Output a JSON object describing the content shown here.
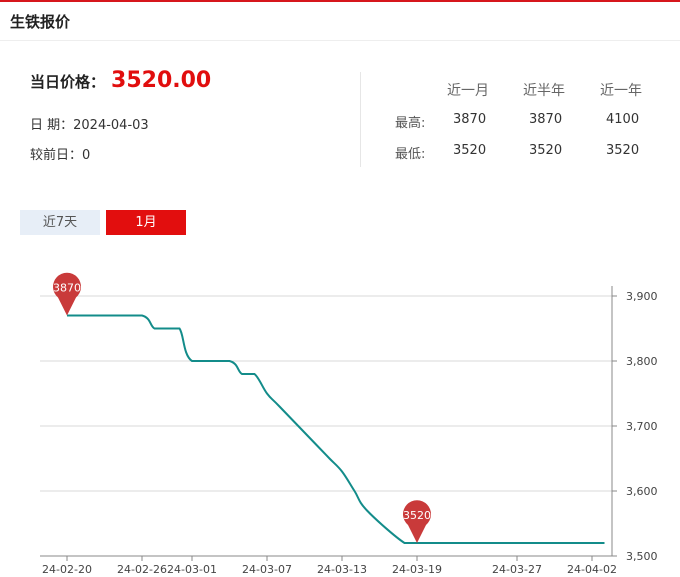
{
  "header": {
    "title": "生铁报价"
  },
  "price": {
    "label": "当日价格：",
    "value": "3520.00",
    "date_text": "日 期：2024-04-03",
    "change_text": "较前日：0"
  },
  "stats": {
    "columns": [
      "近一月",
      "近半年",
      "近一年"
    ],
    "rows": [
      {
        "label": "最高:",
        "values": [
          "3870",
          "3870",
          "4100"
        ]
      },
      {
        "label": "最低:",
        "values": [
          "3520",
          "3520",
          "3520"
        ]
      }
    ]
  },
  "tabs": [
    {
      "label": "近7天",
      "active": false
    },
    {
      "label": "1月",
      "active": true
    }
  ],
  "colors": {
    "accent": "#e10e0e",
    "line": "#138c8a",
    "pin": "#c93a3a"
  },
  "chart_data": {
    "type": "line",
    "title": "",
    "xlabel": "",
    "ylabel": "",
    "ylim": [
      3500,
      3900
    ],
    "yticks": [
      "3,900",
      "3,800",
      "3,700",
      "3,600",
      "3,500"
    ],
    "ytick_values": [
      3900,
      3800,
      3700,
      3600,
      3500
    ],
    "xticks": [
      "24-02-20",
      "24-02-26",
      "24-03-01",
      "24-03-07",
      "24-03-13",
      "24-03-19",
      "24-03-27",
      "24-04-02"
    ],
    "grid": true,
    "series": [
      {
        "x": [
          "24-02-20",
          "24-02-21",
          "24-02-22",
          "24-02-23",
          "24-02-26",
          "24-02-27",
          "24-02-28",
          "24-02-29",
          "24-03-01",
          "24-03-04",
          "24-03-05",
          "24-03-06",
          "24-03-07",
          "24-03-08",
          "24-03-11",
          "24-03-12",
          "24-03-13",
          "24-03-14",
          "24-03-15",
          "24-03-18",
          "24-03-19",
          "24-03-20",
          "24-03-21",
          "24-03-22",
          "24-03-25",
          "24-03-26",
          "24-03-27",
          "24-03-28",
          "24-03-29",
          "24-04-01",
          "24-04-02",
          "24-04-03"
        ],
        "values": [
          3870,
          3870,
          3870,
          3870,
          3870,
          3850,
          3850,
          3850,
          3800,
          3800,
          3780,
          3780,
          3750,
          3730,
          3670,
          3650,
          3630,
          3600,
          3570,
          3520,
          3520,
          3520,
          3520,
          3520,
          3520,
          3520,
          3520,
          3520,
          3520,
          3520,
          3520,
          3520
        ]
      }
    ],
    "markers": [
      {
        "label": "3870",
        "x": "24-02-20",
        "value": 3870
      },
      {
        "label": "3520",
        "x": "24-03-19",
        "value": 3520
      }
    ]
  }
}
